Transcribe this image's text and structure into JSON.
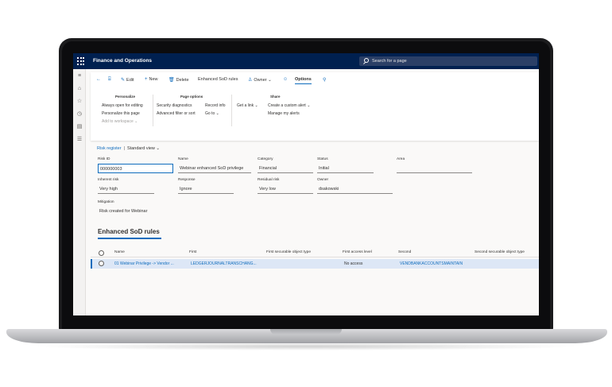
{
  "app": {
    "title": "Finance and Operations"
  },
  "search": {
    "placeholder": "Search for a page"
  },
  "toolbar": {
    "edit": "Edit",
    "new": "New",
    "delete": "Delete",
    "enhanced_sod_rules": "Enhanced SoD rules",
    "owner": "Owner",
    "options": "Options"
  },
  "ribbon": {
    "personalize": {
      "title": "Personalize",
      "items": [
        "Always open for editing",
        "Personalize this page",
        "Add to workspace"
      ]
    },
    "page_options": {
      "title": "Page options",
      "items": [
        "Security diagnostics",
        "Advanced filter or sort",
        "Record info",
        "Go to"
      ]
    },
    "share": {
      "title": "Share",
      "items": [
        "Get a link",
        "Create a custom alert",
        "Manage my alerts"
      ]
    }
  },
  "breadcrumb": {
    "link": "Risk register",
    "separator": "|",
    "view": "Standard view"
  },
  "form": {
    "risk_id": {
      "label": "Risk ID",
      "value": "000000003"
    },
    "name": {
      "label": "Name",
      "value": "Webinar enhanced SoD privilege"
    },
    "category": {
      "label": "Category",
      "value": "Financial"
    },
    "status": {
      "label": "Status",
      "value": "Initial"
    },
    "area": {
      "label": "Area",
      "value": ""
    },
    "inherent_risk": {
      "label": "Inherent risk",
      "value": "Very high"
    },
    "response": {
      "label": "Response",
      "value": "Ignore"
    },
    "residual_risk": {
      "label": "Residual risk",
      "value": "Very low"
    },
    "owner": {
      "label": "Owner",
      "value": "dsakowski"
    },
    "mitigation": {
      "label": "Mitigation",
      "value": "Risk created for Webinar"
    }
  },
  "rules": {
    "title": "Enhanced SoD rules",
    "columns": [
      "Name",
      "First",
      "First securable object type",
      "First access level",
      "Second",
      "Second securable object type"
    ],
    "rows": [
      {
        "name": "01 Webinar Privilege -> Vendor ...",
        "first": "LEDGERJOURNALTRANSCHANG...",
        "first_type": "",
        "first_access": "No access",
        "second": "VENDBANKACCOUNTSMAINTAIN",
        "second_type": ""
      }
    ]
  },
  "colors": {
    "topbar": "#002050",
    "accent": "#0f6cbd",
    "selected_row": "#dde7f6"
  }
}
